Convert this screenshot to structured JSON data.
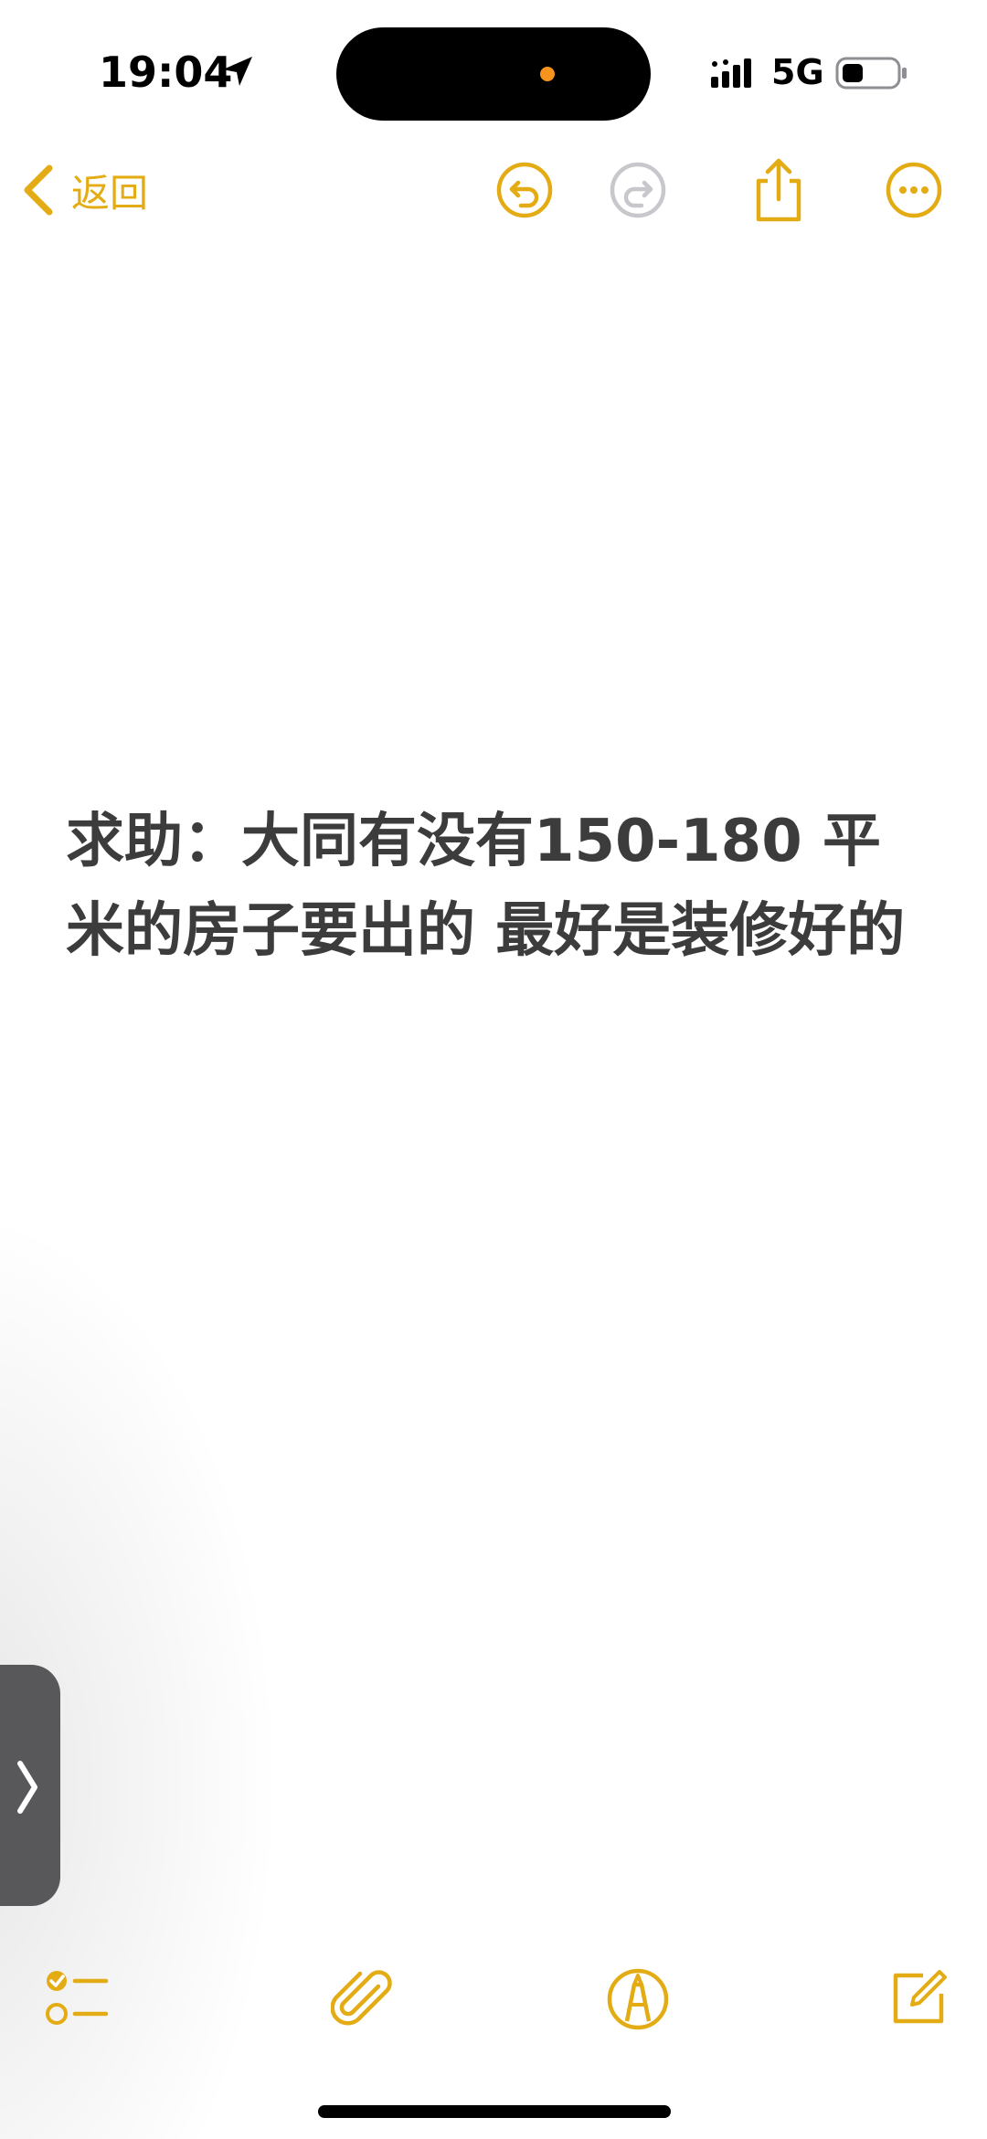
{
  "status_bar": {
    "time": "19:04",
    "network": "5G",
    "icons": [
      "location-arrow-icon",
      "signal-icon",
      "battery-icon"
    ]
  },
  "nav": {
    "back_label": "返回",
    "icons": [
      "back-chevron-icon",
      "undo-icon",
      "redo-icon",
      "share-icon",
      "more-icon"
    ]
  },
  "note": {
    "text": "求助：大同有没有150-180 平米的房子要出的 最好是装修好的"
  },
  "side_handle": {
    "icon": "chevron-right-icon"
  },
  "toolbar": {
    "icons": [
      "checklist-icon",
      "attachment-icon",
      "markup-icon",
      "compose-icon"
    ]
  },
  "colors": {
    "accent": "#e4ac14",
    "text": "#3c3c3c",
    "island_dot": "#f7941d",
    "handle": "#58585a"
  }
}
